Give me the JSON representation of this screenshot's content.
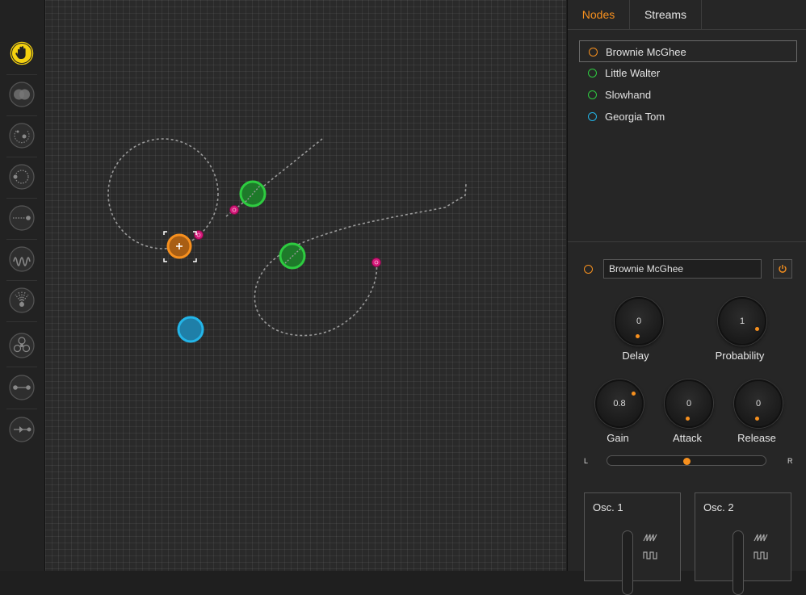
{
  "toolbar": {
    "tools": [
      {
        "name": "hand-tool",
        "icon": "hand-icon",
        "active": true
      },
      {
        "name": "venn-tool",
        "icon": "overlap-circles-icon"
      },
      {
        "name": "orbit-tool",
        "icon": "orbit-icon"
      },
      {
        "name": "circle-tool",
        "icon": "dashed-circle-icon"
      },
      {
        "name": "line-tool",
        "icon": "dashed-line-icon"
      },
      {
        "name": "wave-tool",
        "icon": "wave-icon"
      },
      {
        "name": "fan-tool",
        "icon": "fan-icon"
      },
      {
        "name": "trefoil-tool",
        "icon": "trefoil-icon"
      },
      {
        "name": "link-tool",
        "icon": "link-icon"
      },
      {
        "name": "arrow-tool",
        "icon": "arrow-icon"
      }
    ]
  },
  "colors": {
    "accent": "#f7901e",
    "orange_node": "#f7901e",
    "green_node": "#2ecc40",
    "blue_node": "#23b5e8",
    "magenta": "#d6197a"
  },
  "tabs": {
    "nodes": "Nodes",
    "streams": "Streams"
  },
  "nodes": [
    {
      "label": "Brownie McGhee",
      "color": "#f7901e",
      "selected": true
    },
    {
      "label": "Little Walter",
      "color": "#2ecc40"
    },
    {
      "label": "Slowhand",
      "color": "#2ecc40"
    },
    {
      "label": "Georgia Tom",
      "color": "#23b5e8"
    }
  ],
  "editor": {
    "name_value": "Brownie McGhee",
    "power_icon": "power-icon"
  },
  "knobs": {
    "delay": {
      "label": "Delay",
      "value": "0"
    },
    "probability": {
      "label": "Probability",
      "value": "1"
    },
    "gain": {
      "label": "Gain",
      "value": "0.8"
    },
    "attack": {
      "label": "Attack",
      "value": "0"
    },
    "release": {
      "label": "Release",
      "value": "0"
    }
  },
  "pan": {
    "left_label": "L",
    "right_label": "R",
    "value": 0.5
  },
  "oscillators": [
    {
      "title": "Osc. 1",
      "icons": [
        "sawtooth-wave-icon",
        "square-wave-icon"
      ]
    },
    {
      "title": "Osc. 2",
      "icons": [
        "sawtooth-wave-icon",
        "square-wave-icon"
      ]
    }
  ]
}
